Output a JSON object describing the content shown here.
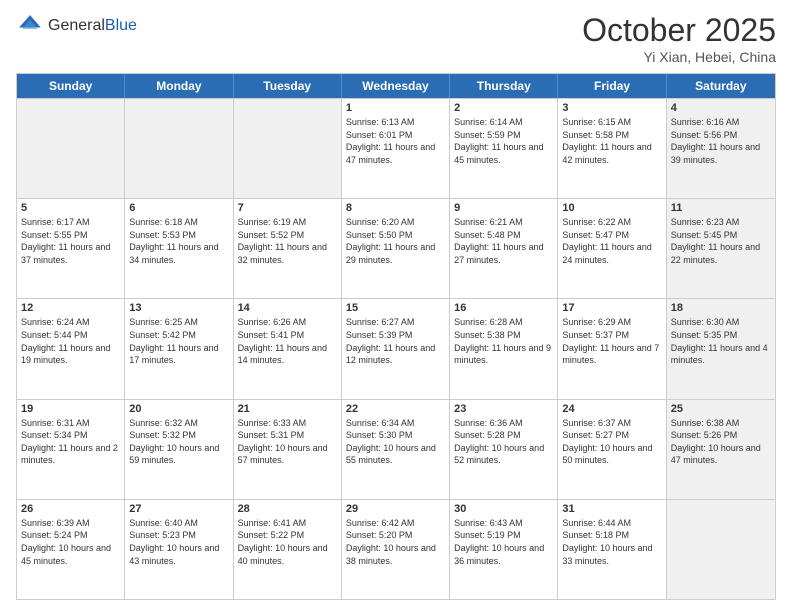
{
  "logo": {
    "general": "General",
    "blue": "Blue"
  },
  "header": {
    "month": "October 2025",
    "location": "Yi Xian, Hebei, China"
  },
  "weekdays": [
    "Sunday",
    "Monday",
    "Tuesday",
    "Wednesday",
    "Thursday",
    "Friday",
    "Saturday"
  ],
  "rows": [
    [
      {
        "day": "",
        "info": "",
        "shaded": true
      },
      {
        "day": "",
        "info": "",
        "shaded": true
      },
      {
        "day": "",
        "info": "",
        "shaded": true
      },
      {
        "day": "1",
        "info": "Sunrise: 6:13 AM\nSunset: 6:01 PM\nDaylight: 11 hours and 47 minutes."
      },
      {
        "day": "2",
        "info": "Sunrise: 6:14 AM\nSunset: 5:59 PM\nDaylight: 11 hours and 45 minutes."
      },
      {
        "day": "3",
        "info": "Sunrise: 6:15 AM\nSunset: 5:58 PM\nDaylight: 11 hours and 42 minutes."
      },
      {
        "day": "4",
        "info": "Sunrise: 6:16 AM\nSunset: 5:56 PM\nDaylight: 11 hours and 39 minutes.",
        "shaded": true
      }
    ],
    [
      {
        "day": "5",
        "info": "Sunrise: 6:17 AM\nSunset: 5:55 PM\nDaylight: 11 hours and 37 minutes."
      },
      {
        "day": "6",
        "info": "Sunrise: 6:18 AM\nSunset: 5:53 PM\nDaylight: 11 hours and 34 minutes."
      },
      {
        "day": "7",
        "info": "Sunrise: 6:19 AM\nSunset: 5:52 PM\nDaylight: 11 hours and 32 minutes."
      },
      {
        "day": "8",
        "info": "Sunrise: 6:20 AM\nSunset: 5:50 PM\nDaylight: 11 hours and 29 minutes."
      },
      {
        "day": "9",
        "info": "Sunrise: 6:21 AM\nSunset: 5:48 PM\nDaylight: 11 hours and 27 minutes."
      },
      {
        "day": "10",
        "info": "Sunrise: 6:22 AM\nSunset: 5:47 PM\nDaylight: 11 hours and 24 minutes."
      },
      {
        "day": "11",
        "info": "Sunrise: 6:23 AM\nSunset: 5:45 PM\nDaylight: 11 hours and 22 minutes.",
        "shaded": true
      }
    ],
    [
      {
        "day": "12",
        "info": "Sunrise: 6:24 AM\nSunset: 5:44 PM\nDaylight: 11 hours and 19 minutes."
      },
      {
        "day": "13",
        "info": "Sunrise: 6:25 AM\nSunset: 5:42 PM\nDaylight: 11 hours and 17 minutes."
      },
      {
        "day": "14",
        "info": "Sunrise: 6:26 AM\nSunset: 5:41 PM\nDaylight: 11 hours and 14 minutes."
      },
      {
        "day": "15",
        "info": "Sunrise: 6:27 AM\nSunset: 5:39 PM\nDaylight: 11 hours and 12 minutes."
      },
      {
        "day": "16",
        "info": "Sunrise: 6:28 AM\nSunset: 5:38 PM\nDaylight: 11 hours and 9 minutes."
      },
      {
        "day": "17",
        "info": "Sunrise: 6:29 AM\nSunset: 5:37 PM\nDaylight: 11 hours and 7 minutes."
      },
      {
        "day": "18",
        "info": "Sunrise: 6:30 AM\nSunset: 5:35 PM\nDaylight: 11 hours and 4 minutes.",
        "shaded": true
      }
    ],
    [
      {
        "day": "19",
        "info": "Sunrise: 6:31 AM\nSunset: 5:34 PM\nDaylight: 11 hours and 2 minutes."
      },
      {
        "day": "20",
        "info": "Sunrise: 6:32 AM\nSunset: 5:32 PM\nDaylight: 10 hours and 59 minutes."
      },
      {
        "day": "21",
        "info": "Sunrise: 6:33 AM\nSunset: 5:31 PM\nDaylight: 10 hours and 57 minutes."
      },
      {
        "day": "22",
        "info": "Sunrise: 6:34 AM\nSunset: 5:30 PM\nDaylight: 10 hours and 55 minutes."
      },
      {
        "day": "23",
        "info": "Sunrise: 6:36 AM\nSunset: 5:28 PM\nDaylight: 10 hours and 52 minutes."
      },
      {
        "day": "24",
        "info": "Sunrise: 6:37 AM\nSunset: 5:27 PM\nDaylight: 10 hours and 50 minutes."
      },
      {
        "day": "25",
        "info": "Sunrise: 6:38 AM\nSunset: 5:26 PM\nDaylight: 10 hours and 47 minutes.",
        "shaded": true
      }
    ],
    [
      {
        "day": "26",
        "info": "Sunrise: 6:39 AM\nSunset: 5:24 PM\nDaylight: 10 hours and 45 minutes."
      },
      {
        "day": "27",
        "info": "Sunrise: 6:40 AM\nSunset: 5:23 PM\nDaylight: 10 hours and 43 minutes."
      },
      {
        "day": "28",
        "info": "Sunrise: 6:41 AM\nSunset: 5:22 PM\nDaylight: 10 hours and 40 minutes."
      },
      {
        "day": "29",
        "info": "Sunrise: 6:42 AM\nSunset: 5:20 PM\nDaylight: 10 hours and 38 minutes."
      },
      {
        "day": "30",
        "info": "Sunrise: 6:43 AM\nSunset: 5:19 PM\nDaylight: 10 hours and 36 minutes."
      },
      {
        "day": "31",
        "info": "Sunrise: 6:44 AM\nSunset: 5:18 PM\nDaylight: 10 hours and 33 minutes."
      },
      {
        "day": "",
        "info": "",
        "shaded": true
      }
    ]
  ]
}
